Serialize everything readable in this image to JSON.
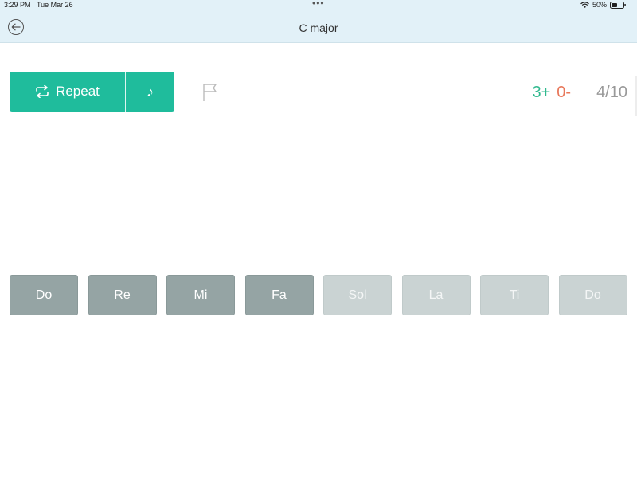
{
  "status_bar": {
    "time": "3:29 PM",
    "date": "Tue Mar 26",
    "dots": "•••",
    "battery": "50%"
  },
  "nav": {
    "title": "C major",
    "back_icon": "arrow-left-circle-icon"
  },
  "controls": {
    "repeat_label": "Repeat",
    "repeat_icon": "repeat-arrows-icon",
    "note_icon": "music-note-icon",
    "note_glyph": "♪",
    "flag_icon": "flag-outline-icon"
  },
  "score": {
    "correct": "3+",
    "wrong": "0-",
    "progress": "4/10"
  },
  "keys": [
    {
      "label": "Do",
      "state": "active"
    },
    {
      "label": "Re",
      "state": "active"
    },
    {
      "label": "Mi",
      "state": "active"
    },
    {
      "label": "Fa",
      "state": "active"
    },
    {
      "label": "Sol",
      "state": "inactive"
    },
    {
      "label": "La",
      "state": "inactive"
    },
    {
      "label": "Ti",
      "state": "inactive"
    },
    {
      "label": "Do",
      "state": "inactive"
    }
  ],
  "colors": {
    "accent": "#1fbc9c",
    "nav_bg": "#e2f1f8",
    "key_active": "#95a4a4",
    "key_inactive": "#cad3d3",
    "correct": "#2fb98e",
    "wrong": "#e8775a"
  }
}
